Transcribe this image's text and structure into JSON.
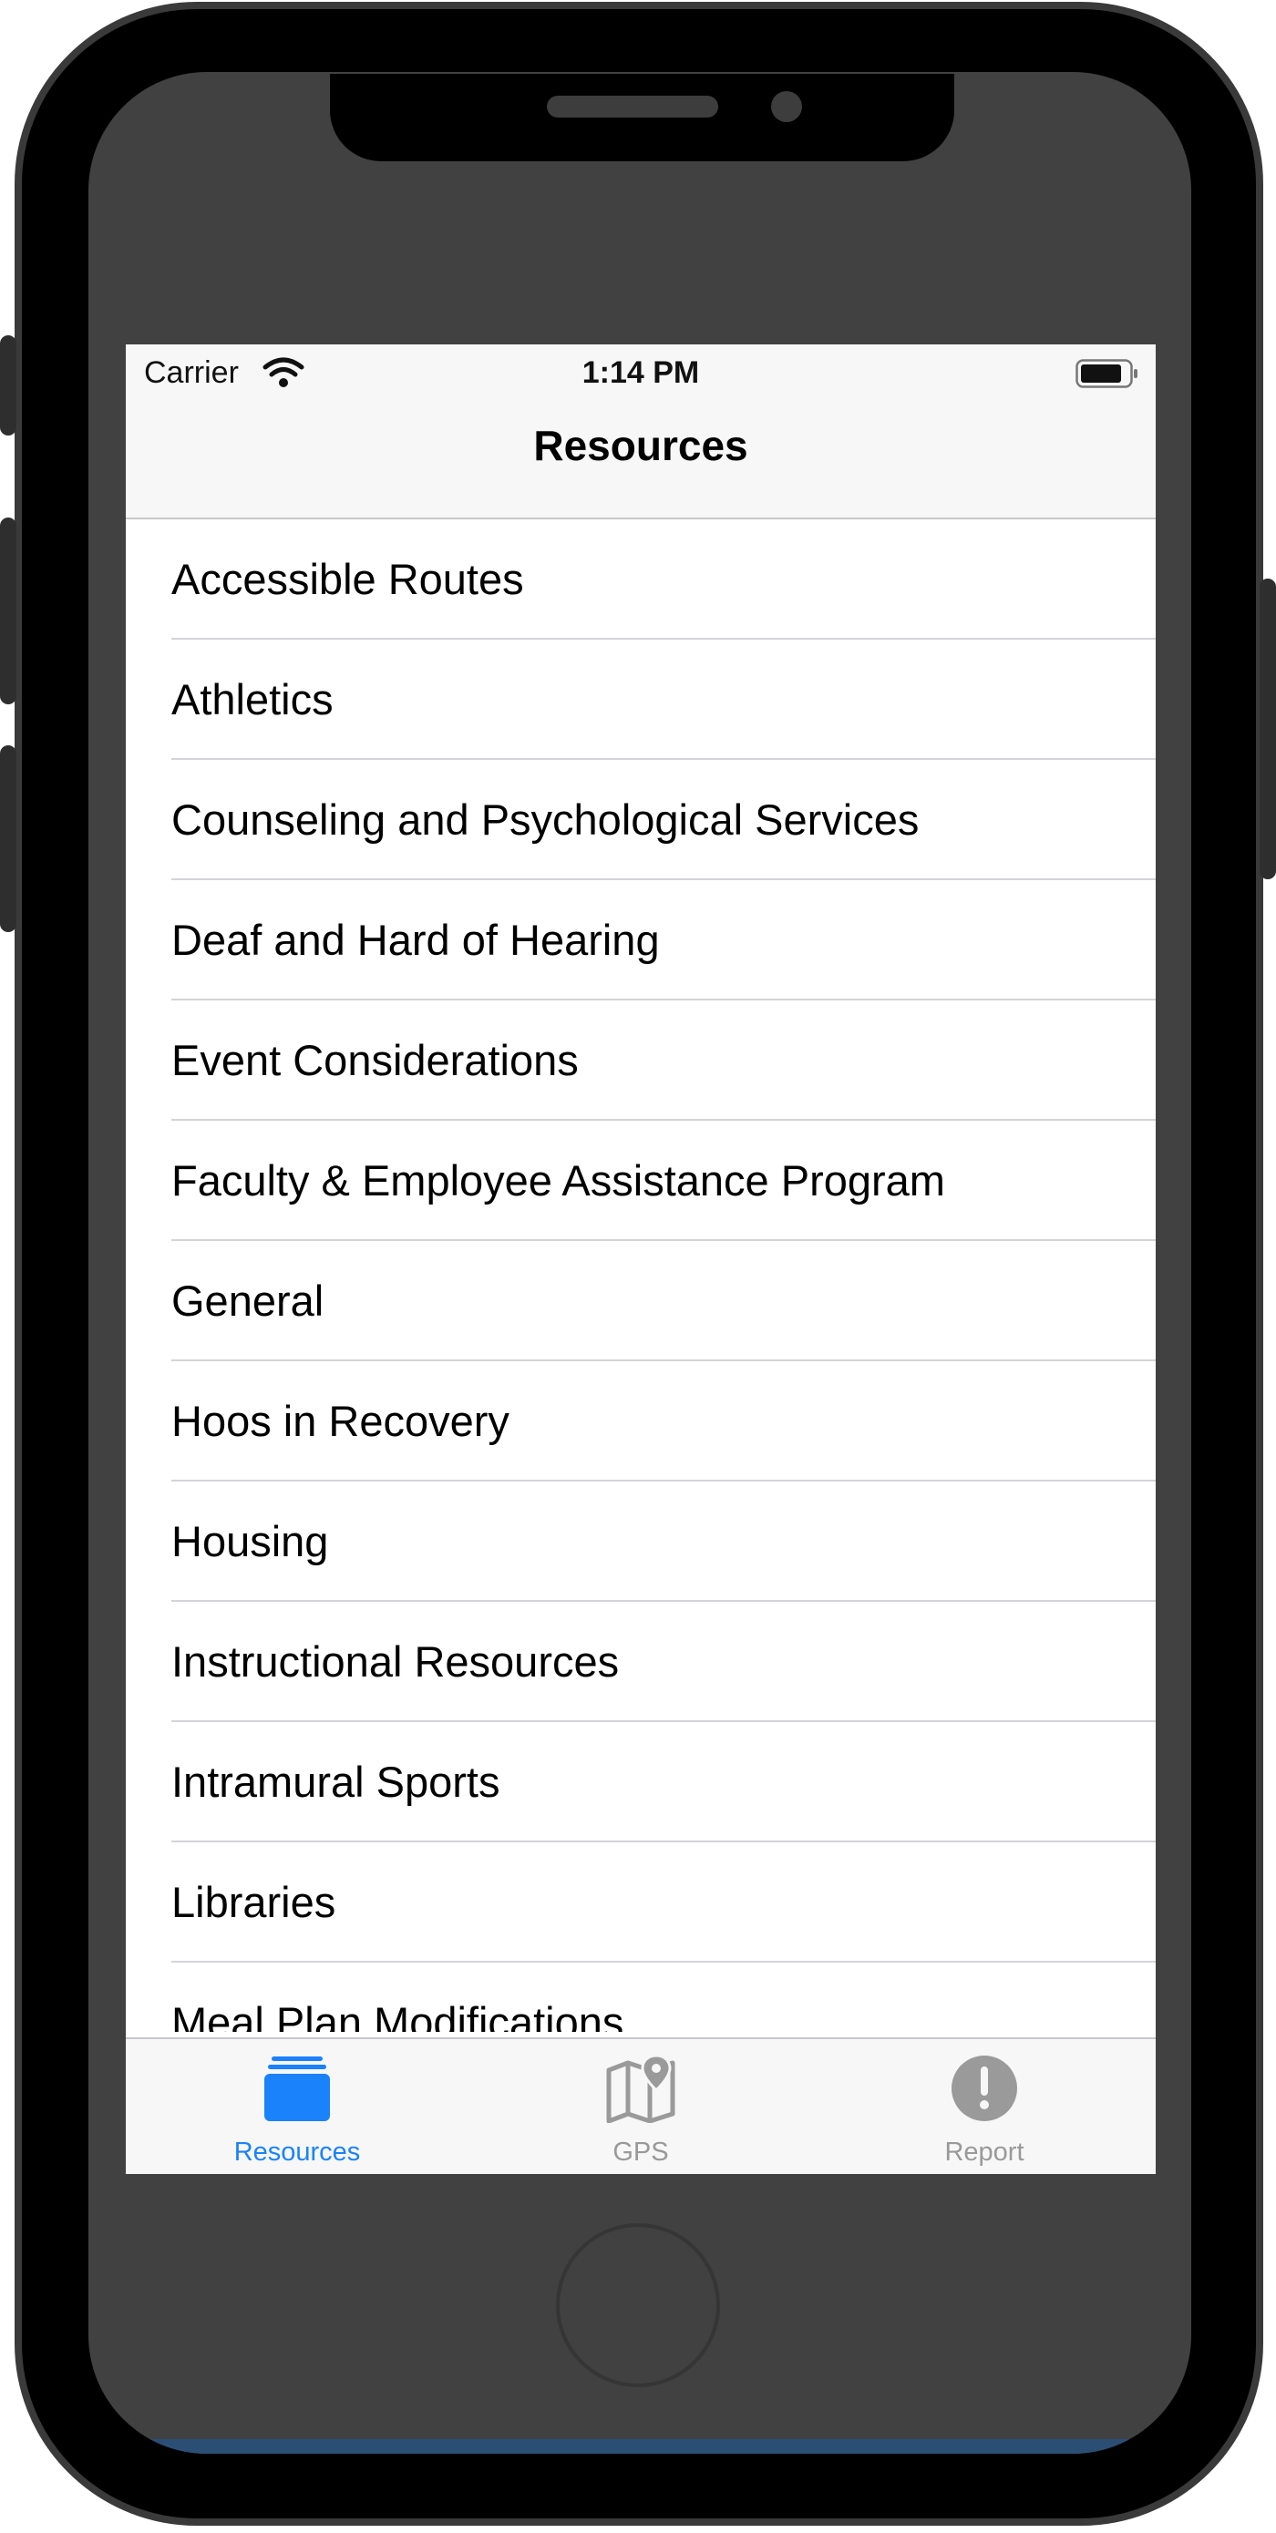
{
  "status_bar": {
    "carrier": "Carrier",
    "time": "1:14 PM",
    "wifi_icon": "wifi-icon",
    "battery_icon": "battery-icon"
  },
  "nav": {
    "title": "Resources"
  },
  "list": {
    "items": [
      {
        "label": "Accessible Routes"
      },
      {
        "label": "Athletics"
      },
      {
        "label": "Counseling and Psychological Services"
      },
      {
        "label": "Deaf and Hard of Hearing"
      },
      {
        "label": "Event Considerations"
      },
      {
        "label": "Faculty & Employee Assistance Program"
      },
      {
        "label": "General"
      },
      {
        "label": "Hoos in Recovery"
      },
      {
        "label": "Housing"
      },
      {
        "label": "Instructional Resources"
      },
      {
        "label": "Intramural Sports"
      },
      {
        "label": "Libraries"
      },
      {
        "label": "Meal Plan Modifications"
      }
    ]
  },
  "tab_bar": {
    "tabs": [
      {
        "label": "Resources",
        "icon": "stack-icon",
        "selected": true
      },
      {
        "label": "GPS",
        "icon": "map-pin-icon",
        "selected": false
      },
      {
        "label": "Report",
        "icon": "exclamation-icon",
        "selected": false
      }
    ]
  },
  "colors": {
    "tint": "#1a82fb",
    "inactive": "#999999",
    "bezel": "#414141"
  }
}
